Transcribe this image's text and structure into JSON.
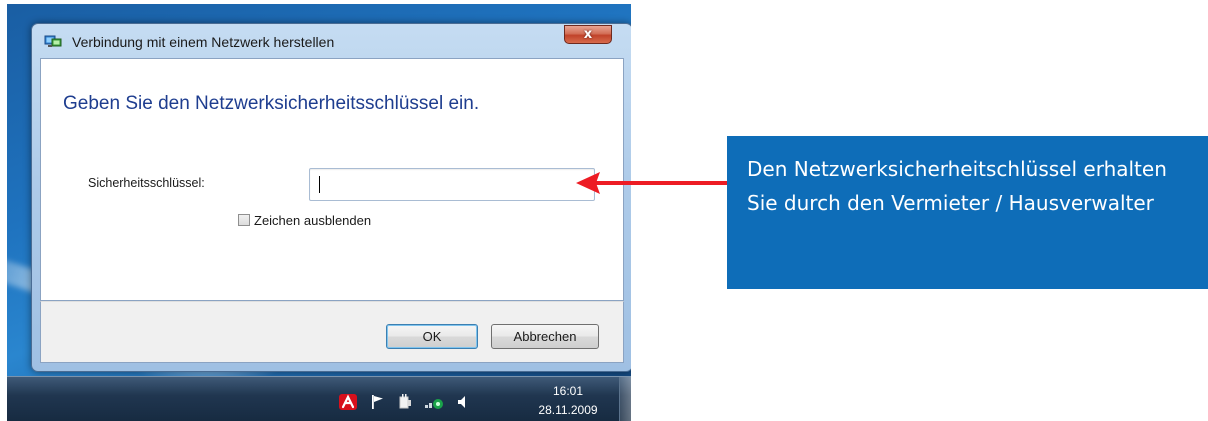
{
  "dialog": {
    "title": "Verbindung mit einem Netzwerk herstellen",
    "close_symbol": "x",
    "heading": "Geben Sie den Netzwerksicherheitsschlüssel ein.",
    "key_label": "Sicherheitsschlüssel:",
    "key_value": "",
    "hide_chars_label": "Zeichen ausblenden",
    "hide_chars_checked": false,
    "ok_label": "OK",
    "cancel_label": "Abbrechen",
    "title_icon": "network-icon"
  },
  "taskbar": {
    "tray_icons": [
      "avira-icon",
      "flag-icon",
      "power-icon",
      "network-icon",
      "speaker-icon"
    ],
    "time": "16:01",
    "date": "28.11.2009"
  },
  "annotation": {
    "text": "Den Netzwerksicherheitschlüssel erhalten Sie durch den Vermieter / Hausverwalter",
    "box_color": "#0e6db8",
    "arrow_color": "#ed1c24"
  }
}
